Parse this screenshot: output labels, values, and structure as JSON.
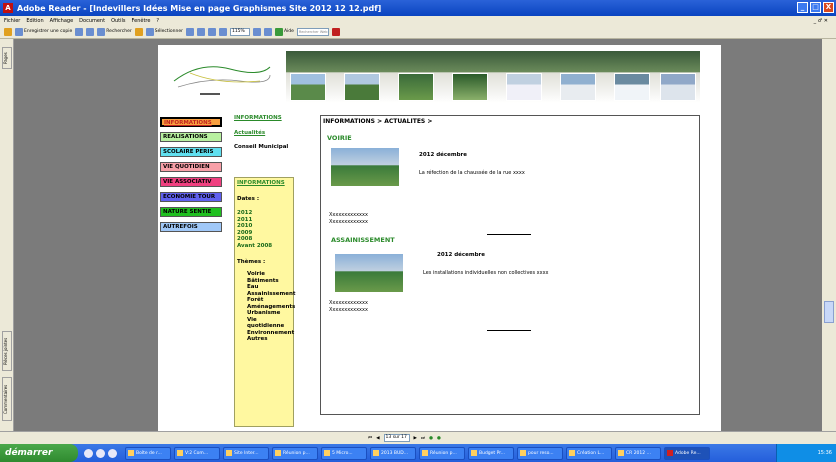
{
  "window": {
    "title": "Adobe Reader - [Indevillers Idées Mise en page Graphismes Site 2012 12 12.pdf]",
    "min": "_",
    "max": "□",
    "close": "X"
  },
  "menu": [
    "Fichier",
    "Edition",
    "Affichage",
    "Document",
    "Outils",
    "Fenêtre",
    "?"
  ],
  "menu_right": "_ ♂ ✕",
  "toolbar": {
    "save_copy": "Enregistrer une copie",
    "search": "Rechercher",
    "select": "Sélectionner",
    "zoom": "115%",
    "help": "Aide",
    "search_placeholder": "Rechercher Web"
  },
  "side_tabs": {
    "pages": "Pages",
    "layers": "Pièces jointes",
    "comments": "Commentaires"
  },
  "page_nav": {
    "page_value": "13 sur 17"
  },
  "nav_buttons": [
    {
      "label": "INFORMATIONS",
      "color": "#f8a040"
    },
    {
      "label": "REALISATIONS",
      "color": "#b8f0a0"
    },
    {
      "label": "SCOLAIRE PERIS",
      "color": "#60e0f0"
    },
    {
      "label": "VIE QUOTIDIEN",
      "color": "#f8a0a8"
    },
    {
      "label": "VIE ASSOCIATIV",
      "color": "#f04080"
    },
    {
      "label": "ECONOMIE TOUR",
      "color": "#6060f0"
    },
    {
      "label": "NATURE SENTIE",
      "color": "#20c020"
    },
    {
      "label": "AUTREFOIS",
      "color": "#a0c8f8"
    }
  ],
  "col2": {
    "title": "INFORMATIONS",
    "link": "Actualités",
    "council": "Conseil Municipal"
  },
  "box2": {
    "title": "INFORMATIONS",
    "dates_label": "Dates :",
    "years": [
      "2012",
      "2011",
      "2010",
      "2009",
      "2008",
      "Avant 2008"
    ],
    "themes_label": "Thèmes :",
    "themes": [
      "Voirie",
      "Bâtiments",
      "Eau",
      "Assainissement",
      "Forêt",
      "Aménagements",
      "Urbanisme",
      "Vie quotidienne",
      "Environnement",
      "Autres"
    ]
  },
  "main": {
    "breadcrumb": "INFORMATIONS > ACTUALITES >",
    "s1_title": "VOIRIE",
    "s1_date": "2012 décembre",
    "s1_text": "La réfection de la chaussée de la rue xxxx",
    "s1_x1": "Xxxxxxxxxxxxx",
    "s1_x2": "Xxxxxxxxxxxxx",
    "s2_title": "ASSAINISSEMENT",
    "s2_date": "2012 décembre",
    "s2_text": "Les installations individuelles non collectives xxxx",
    "s2_x1": "Xxxxxxxxxxxxx",
    "s2_x2": "Xxxxxxxxxxxxx"
  },
  "taskbar": {
    "start": "démarrer",
    "tasks": [
      "Boîte de r...",
      "V:2 Com...",
      "Site Inter...",
      "Réunion p...",
      "5 Micro...",
      "2013 BUD...",
      "Réunion p...",
      "Budget Pr...",
      "pour reso...",
      "Création L...",
      "CR 2012 ...",
      "Adobe Re..."
    ],
    "clock": "15:36"
  }
}
